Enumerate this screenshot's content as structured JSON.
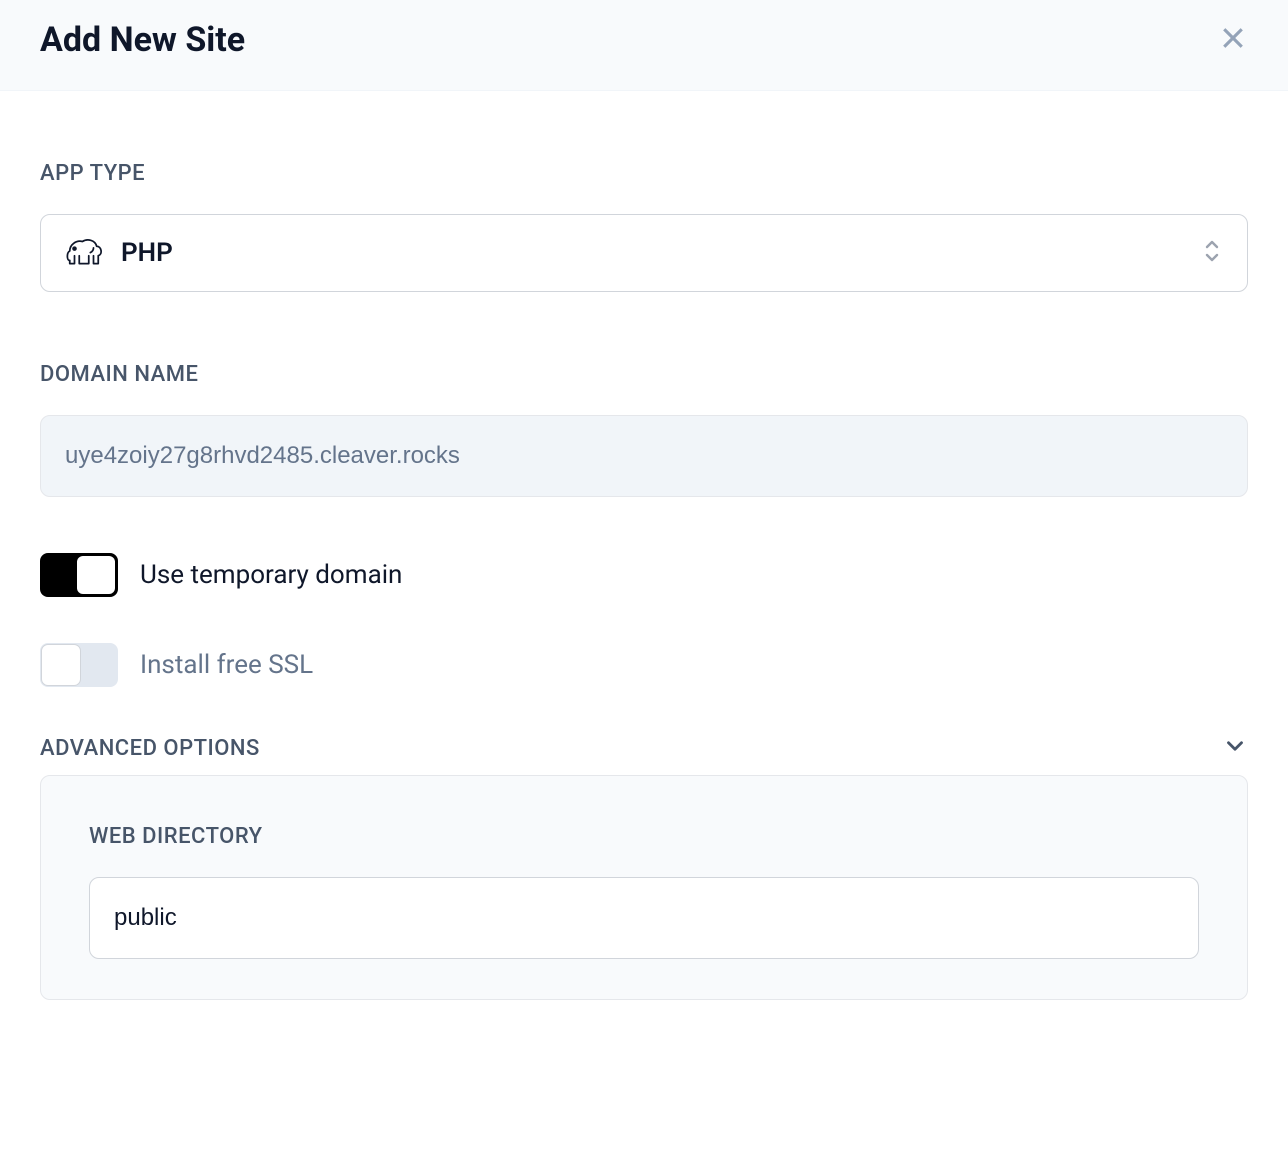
{
  "header": {
    "title": "Add New Site"
  },
  "app_type": {
    "label": "APP TYPE",
    "selected": "PHP"
  },
  "domain": {
    "label": "DOMAIN NAME",
    "value": "uye4zoiy27g8rhvd2485.cleaver.rocks"
  },
  "toggles": {
    "temp_domain": {
      "label": "Use temporary domain",
      "on": true
    },
    "ssl": {
      "label": "Install free SSL",
      "on": false
    }
  },
  "advanced": {
    "label": "ADVANCED OPTIONS",
    "web_directory": {
      "label": "WEB DIRECTORY",
      "value": "public"
    }
  }
}
